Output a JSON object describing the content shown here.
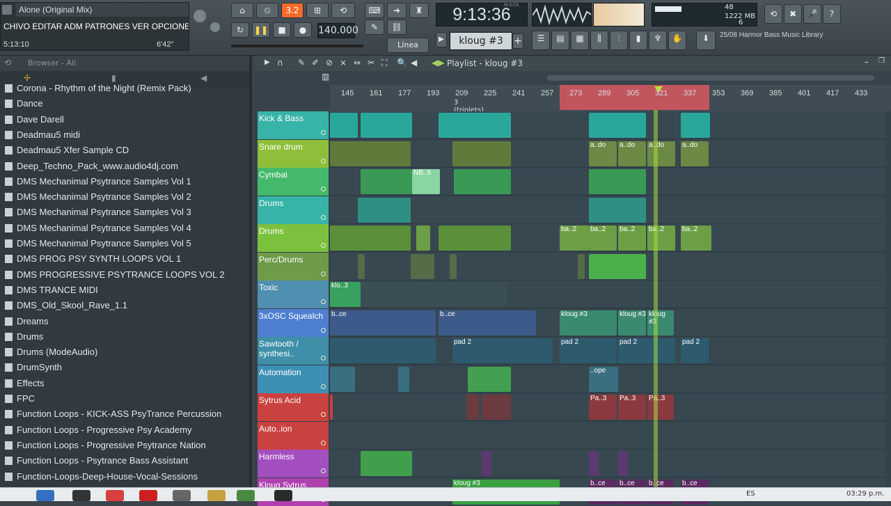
{
  "hint": {
    "song": "Alone (Original Mix)",
    "menu": "CHIVO EDITAR ADM PATRONES VER OPCIONES INSTR ?",
    "time_left": "5:13:10",
    "time_right": "6'42\""
  },
  "transport": {
    "pat_song": "3.2",
    "tempo": "140.000",
    "clock": "9:13:36",
    "clock_label": "M:S:CS",
    "snap": "Línea",
    "pattern": "kloug #3",
    "mem": "1222 MB",
    "cpu": "48",
    "poly": "6",
    "news": "25/08 Harmor Bass Music Library"
  },
  "browser": {
    "title": "Browser - All",
    "items": [
      "Corona - Rhythm of the Night (Remix Pack)",
      "Dance",
      "Dave Darell",
      "Deadmau5 midi",
      "Deadmau5 Xfer Sample CD",
      "Deep_Techno_Pack_www.audio4dj.com",
      "DMS Mechanimal Psytrance Samples Vol 1",
      "DMS Mechanimal Psytrance Samples Vol 2",
      "DMS Mechanimal Psytrance Samples Vol 3",
      "DMS Mechanimal Psytrance Samples Vol 4",
      "DMS Mechanimal Psytrance Samples Vol 5",
      "DMS PROG PSY SYNTH LOOPS VOL 1",
      "DMS PROGRESSIVE PSYTRANCE LOOPS VOL 2",
      "DMS TRANCE MIDI",
      "DMS_Old_Skool_Rave_1.1",
      "Dreams",
      "Drums",
      "Drums (ModeAudio)",
      "DrumSynth",
      "Effects",
      "FPC",
      "Function Loops - KICK-ASS PsyTrance Percussion",
      "Function Loops - Progressive Psy Academy",
      "Function Loops - Progressive Psytrance Nation",
      "Function Loops - Psytrance Bass Assistant",
      "Function-Loops-Deep-House-Vocal-Sessions"
    ]
  },
  "playlist": {
    "title": "Playlist - kloug #3",
    "triplets": "3 (triplets)",
    "ruler": [
      "145",
      "161",
      "177",
      "193",
      "209",
      "225",
      "241",
      "257",
      "273",
      "289",
      "305",
      "321",
      "337",
      "353",
      "369",
      "385",
      "401",
      "417",
      "433"
    ],
    "tracks": [
      {
        "name": "Kick & Bass",
        "color": "#38b3a7"
      },
      {
        "name": "Snare drum",
        "color": "#8fbf3a"
      },
      {
        "name": "Cymbal",
        "color": "#45b96b"
      },
      {
        "name": "Drums",
        "color": "#38b3a7"
      },
      {
        "name": "Drums",
        "color": "#7cc13d"
      },
      {
        "name": "Perc/Drums",
        "color": "#6f9a4a"
      },
      {
        "name": "Toxic",
        "color": "#4f8fb0"
      },
      {
        "name": "3xOSC Squealch",
        "color": "#4f7fd0"
      },
      {
        "name": "Sawtooth / synthesi..",
        "color": "#3f8fa8"
      },
      {
        "name": "Automation",
        "color": "#3d8fb4"
      },
      {
        "name": "Sytrus Acid",
        "color": "#c9423f"
      },
      {
        "name": "Auto..ion",
        "color": "#c9423f"
      },
      {
        "name": "Harmless",
        "color": "#a34fc0"
      },
      {
        "name": "Kloug Sytrus",
        "color": "#b040b0"
      }
    ],
    "clip_labels": {
      "cymbal": "NB..5",
      "snare": "a..do",
      "drums": "ba..2",
      "toxic": "klo..3",
      "squealch": "b..ce",
      "squealch2": "kloug #3",
      "saw": "pad 2",
      "auto": "..ope",
      "sytrus": "Pa..3",
      "kloug": "kloug #3",
      "kloug2": "b..ce"
    }
  },
  "taskbar": {
    "lang": "ES",
    "time": "03:29 p.m."
  }
}
